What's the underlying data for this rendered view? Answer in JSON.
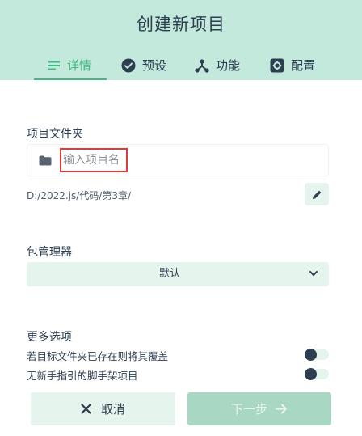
{
  "header": {
    "title": "创建新项目",
    "tabs": [
      {
        "label": "详情",
        "icon": "details-list-icon",
        "active": true
      },
      {
        "label": "预设",
        "icon": "check-circle-icon",
        "active": false
      },
      {
        "label": "功能",
        "icon": "features-fork-icon",
        "active": false
      },
      {
        "label": "配置",
        "icon": "settings-box-icon",
        "active": false
      }
    ]
  },
  "project_folder": {
    "label": "项目文件夹",
    "placeholder": "输入项目名",
    "value": "",
    "path": "D:/2022.js/代码/第3章/",
    "folder_icon": "folder-icon",
    "edit_icon": "pencil-icon"
  },
  "package_manager": {
    "label": "包管理器",
    "selected": "默认"
  },
  "more_options": {
    "label": "更多选项",
    "options": [
      {
        "label": "若目标文件夹已存在则将其覆盖",
        "enabled": false
      },
      {
        "label": "无新手指引的脚手架项目",
        "enabled": false
      }
    ]
  },
  "footer": {
    "cancel_label": "取消",
    "next_label": "下一步"
  },
  "colors": {
    "header_bg": "#c3e8dc",
    "accent": "#42b983",
    "field_bg": "#e6f4ee",
    "next_disabled_bg": "#a8d7c3",
    "highlight_border": "#e53935"
  }
}
